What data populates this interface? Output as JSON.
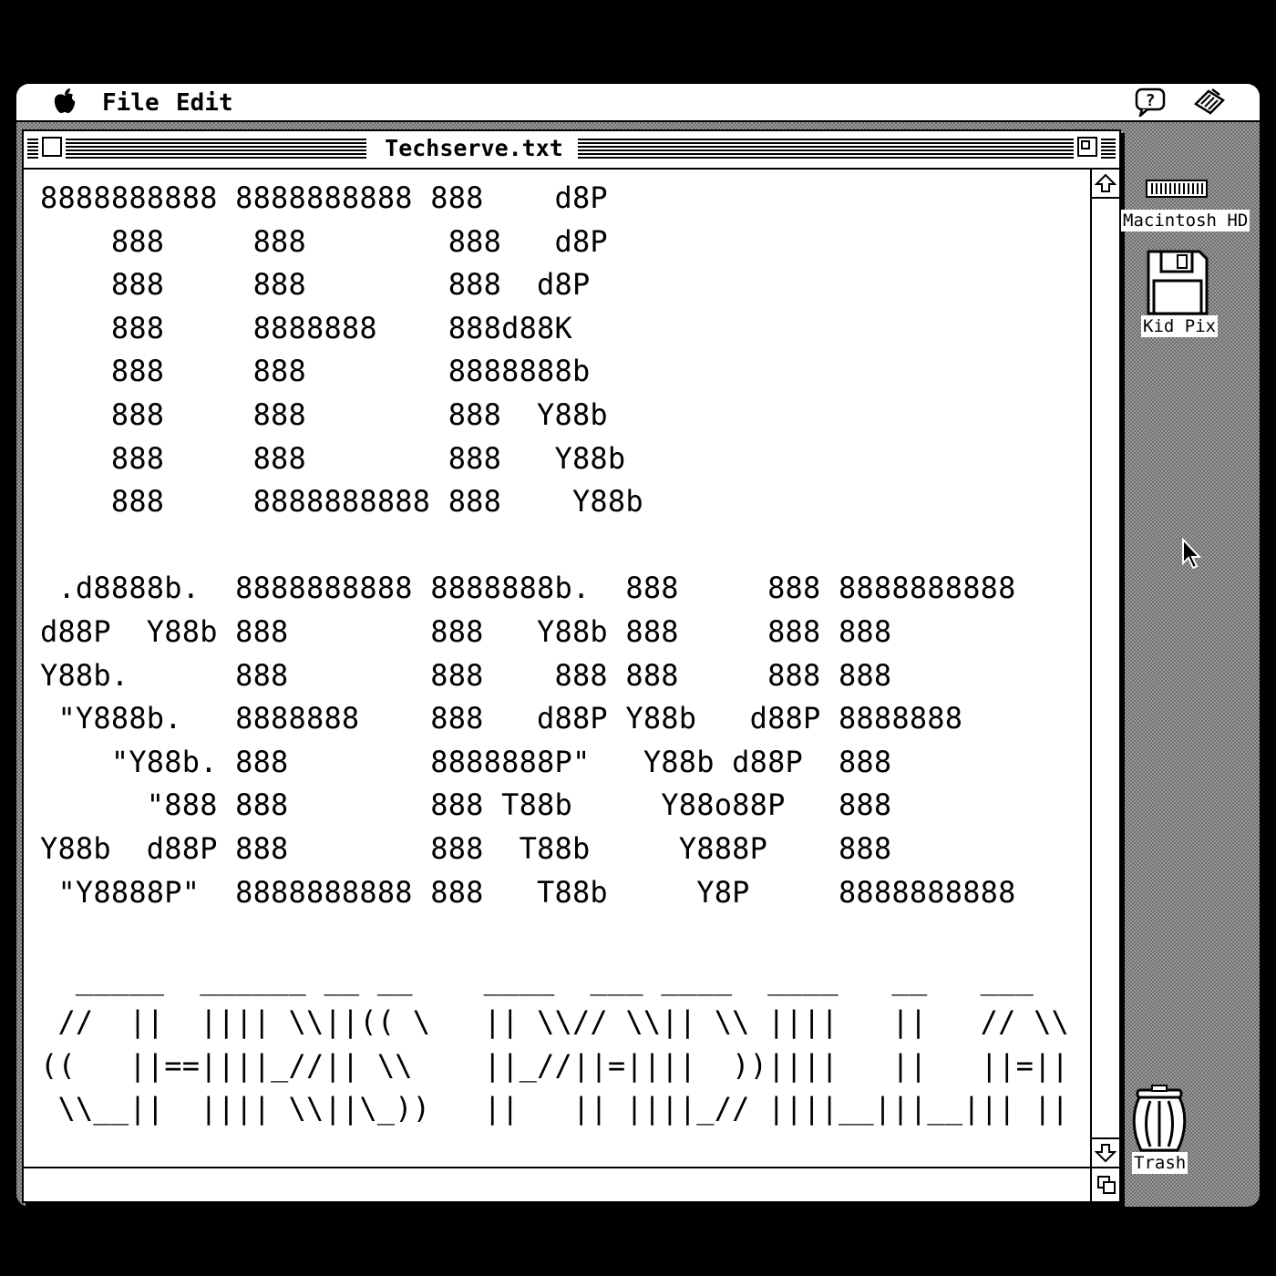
{
  "menubar": {
    "apple_glyph": "",
    "file_label": "File",
    "edit_label": "Edit",
    "help_icon": "balloon-help-icon",
    "app_icon": "application-menu-icon"
  },
  "window": {
    "title": "Techserve.txt",
    "lines": [
      "8888888888 8888888888 888    d8P",
      "    888     888        888   d8P",
      "    888     888        888  d8P",
      "    888     8888888    888d88K",
      "    888     888        8888888b",
      "    888     888        888  Y88b",
      "    888     888        888   Y88b",
      "    888     8888888888 888    Y88b",
      "",
      " .d8888b.  8888888888 8888888b.  888     888 8888888888",
      "d88P  Y88b 888        888   Y88b 888     888 888",
      "Y88b.      888        888    888 888     888 888",
      " \"Y888b.   8888888    888   d88P Y88b   d88P 8888888",
      "    \"Y88b. 888        8888888P\"   Y88b d88P  888",
      "      \"888 888        888 T88b     Y88o88P   888",
      "Y88b  d88P 888        888  T88b     Y888P    888",
      " \"Y8888P\"  8888888888 888   T88b     Y8P     8888888888",
      "",
      "  _____  ______ __ __    ____  ___ ____  ____   __   ___",
      " //  ||  |||| \\\\||(( \\   || \\\\// \\\\|| \\\\ ||||   ||   // \\\\",
      "((   ||==||||_//|| \\\\    ||_//||=||||  ))||||   ||   ||=||",
      " \\\\__||  |||| \\\\||\\_))   ||   || ||||_// ||||__|||__||| ||"
    ]
  },
  "desktop": {
    "hd_label": "Macintosh HD",
    "disk_label": "Kid Pix",
    "trash_label": "Trash"
  },
  "colors": {
    "desktop_light": "#9a9a9a",
    "desktop_dark": "#6e6e6e",
    "window_bg": "#ffffff",
    "ink": "#000000"
  }
}
